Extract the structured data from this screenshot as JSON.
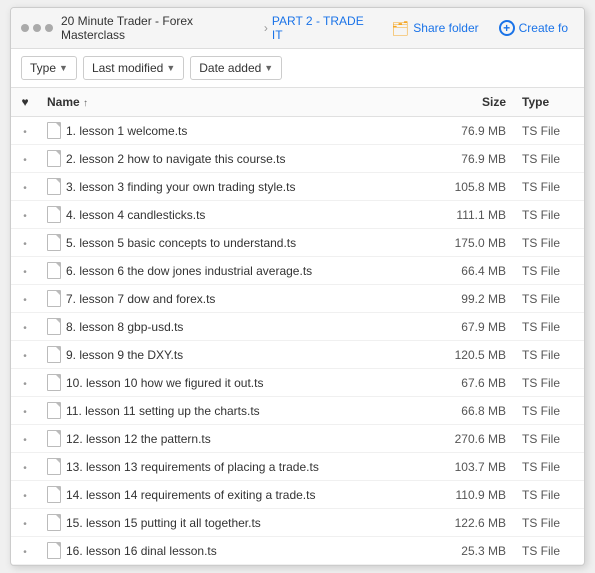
{
  "window": {
    "title": "PART 2 - TRADE IT"
  },
  "breadcrumb": {
    "dots": "•••",
    "items": [
      {
        "label": "20 Minute Trader - Forex Masterclass",
        "active": false
      },
      {
        "label": "PART 2 - TRADE IT",
        "active": true
      }
    ]
  },
  "actions": {
    "share_label": "Share folder",
    "create_label": "Create fo"
  },
  "toolbar": {
    "filters": [
      {
        "label": "Type"
      },
      {
        "label": "Last modified"
      },
      {
        "label": "Date added"
      }
    ]
  },
  "table": {
    "columns": {
      "fav": "♥",
      "name": "Name",
      "sort_arrow": "↑",
      "size": "Size",
      "type": "Type"
    },
    "rows": [
      {
        "id": 1,
        "name": "1. lesson 1 welcome.ts",
        "size": "76.9 MB",
        "type": "TS File"
      },
      {
        "id": 2,
        "name": "2. lesson 2 how to navigate this course.ts",
        "size": "76.9 MB",
        "type": "TS File"
      },
      {
        "id": 3,
        "name": "3. lesson 3 finding your own trading style.ts",
        "size": "105.8 MB",
        "type": "TS File"
      },
      {
        "id": 4,
        "name": "4. lesson 4 candlesticks.ts",
        "size": "111.1 MB",
        "type": "TS File"
      },
      {
        "id": 5,
        "name": "5. lesson 5 basic concepts to understand.ts",
        "size": "175.0 MB",
        "type": "TS File"
      },
      {
        "id": 6,
        "name": "6. lesson 6 the dow jones industrial average.ts",
        "size": "66.4 MB",
        "type": "TS File"
      },
      {
        "id": 7,
        "name": "7. lesson 7 dow and forex.ts",
        "size": "99.2 MB",
        "type": "TS File"
      },
      {
        "id": 8,
        "name": "8. lesson 8 gbp-usd.ts",
        "size": "67.9 MB",
        "type": "TS File"
      },
      {
        "id": 9,
        "name": "9. lesson 9 the DXY.ts",
        "size": "120.5 MB",
        "type": "TS File"
      },
      {
        "id": 10,
        "name": "10. lesson 10 how we figured it out.ts",
        "size": "67.6 MB",
        "type": "TS File"
      },
      {
        "id": 11,
        "name": "11. lesson 11 setting up the charts.ts",
        "size": "66.8 MB",
        "type": "TS File"
      },
      {
        "id": 12,
        "name": "12. lesson 12 the pattern.ts",
        "size": "270.6 MB",
        "type": "TS File"
      },
      {
        "id": 13,
        "name": "13. lesson 13 requirements of placing a trade.ts",
        "size": "103.7 MB",
        "type": "TS File"
      },
      {
        "id": 14,
        "name": "14. lesson 14 requirements of exiting a trade.ts",
        "size": "110.9 MB",
        "type": "TS File"
      },
      {
        "id": 15,
        "name": "15. lesson 15 putting it all together.ts",
        "size": "122.6 MB",
        "type": "TS File"
      },
      {
        "id": 16,
        "name": "16. lesson 16 dinal lesson.ts",
        "size": "25.3 MB",
        "type": "TS File"
      }
    ]
  }
}
